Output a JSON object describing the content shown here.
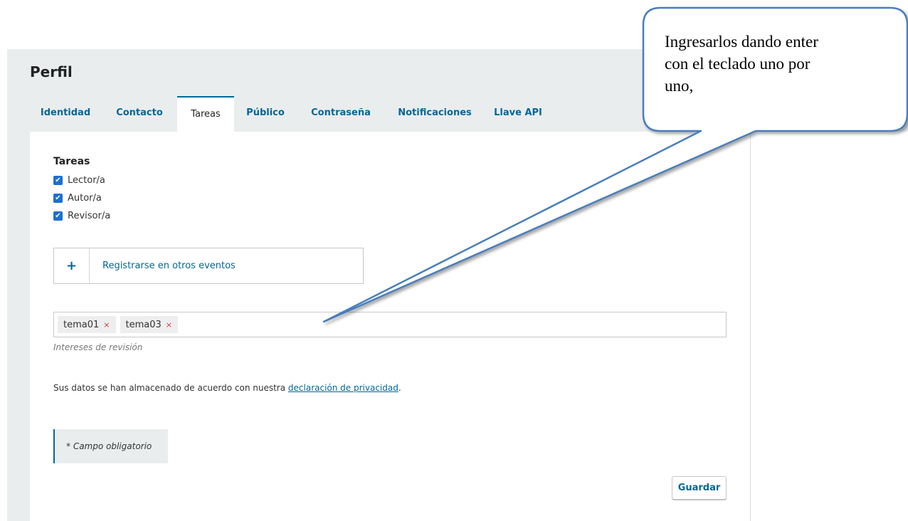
{
  "page": {
    "title": "Perfil"
  },
  "tabs": [
    {
      "label": "Identidad",
      "active": false
    },
    {
      "label": "Contacto",
      "active": false
    },
    {
      "label": "Tareas",
      "active": true
    },
    {
      "label": "Público",
      "active": false
    },
    {
      "label": "Contraseña",
      "active": false
    },
    {
      "label": "Notificaciones",
      "active": false
    },
    {
      "label": "Llave API",
      "active": false
    }
  ],
  "roles": {
    "title": "Tareas",
    "items": [
      {
        "label": "Lector/a",
        "checked": true
      },
      {
        "label": "Autor/a",
        "checked": true
      },
      {
        "label": "Revisor/a",
        "checked": true
      }
    ]
  },
  "register_other": {
    "icon": "plus-icon",
    "label": "Registrarse en otros eventos"
  },
  "review_interests": {
    "tags": [
      {
        "label": "tema01",
        "remove": "×"
      },
      {
        "label": "tema03",
        "remove": "×"
      }
    ],
    "description": "Intereses de revisión"
  },
  "privacy": {
    "text": "Sus datos se han almacenado de acuerdo con nuestra ",
    "link": "declaración de privacidad",
    "suffix": "."
  },
  "required_note": "* Campo obligatorio",
  "save_label": "Guardar",
  "callout": {
    "lines": [
      "Ingresarlos dando enter",
      "con el teclado uno por",
      "uno,"
    ]
  },
  "colors": {
    "accent": "#006798",
    "checkbox": "#1d6fd3",
    "callout_border": "#4a7ebb",
    "header_bg": "#eaedee"
  }
}
